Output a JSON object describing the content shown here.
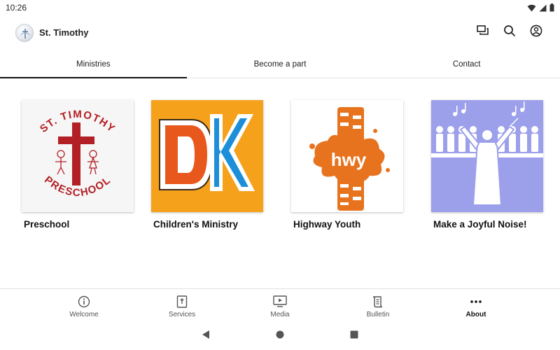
{
  "status": {
    "time": "10:26"
  },
  "app": {
    "title": "St. Timothy"
  },
  "tabs": [
    {
      "label": "Ministries",
      "active": true
    },
    {
      "label": "Become a part",
      "active": false
    },
    {
      "label": "Contact",
      "active": false
    }
  ],
  "cards": [
    {
      "title": "Preschool",
      "image_text_top": "ST. TIMOTHY",
      "image_text_bottom": "PRESCHOOL"
    },
    {
      "title": "Children's Ministry",
      "image_text": "DK"
    },
    {
      "title": "Highway Youth",
      "image_text": "hwy"
    },
    {
      "title": "Make a Joyful Noise!"
    }
  ],
  "bottom_nav": [
    {
      "label": "Welcome",
      "icon": "info-icon",
      "active": false
    },
    {
      "label": "Services",
      "icon": "book-cross-icon",
      "active": false
    },
    {
      "label": "Media",
      "icon": "play-screen-icon",
      "active": false
    },
    {
      "label": "Bulletin",
      "icon": "scroll-icon",
      "active": false
    },
    {
      "label": "About",
      "icon": "more-dots-icon",
      "active": true
    }
  ],
  "colors": {
    "preschool_red": "#b22025",
    "dk_orange": "#f5a11c",
    "dk_blue": "#1d8fd8",
    "hwy_orange": "#e8731e",
    "choir_bg": "#9c9fea"
  }
}
